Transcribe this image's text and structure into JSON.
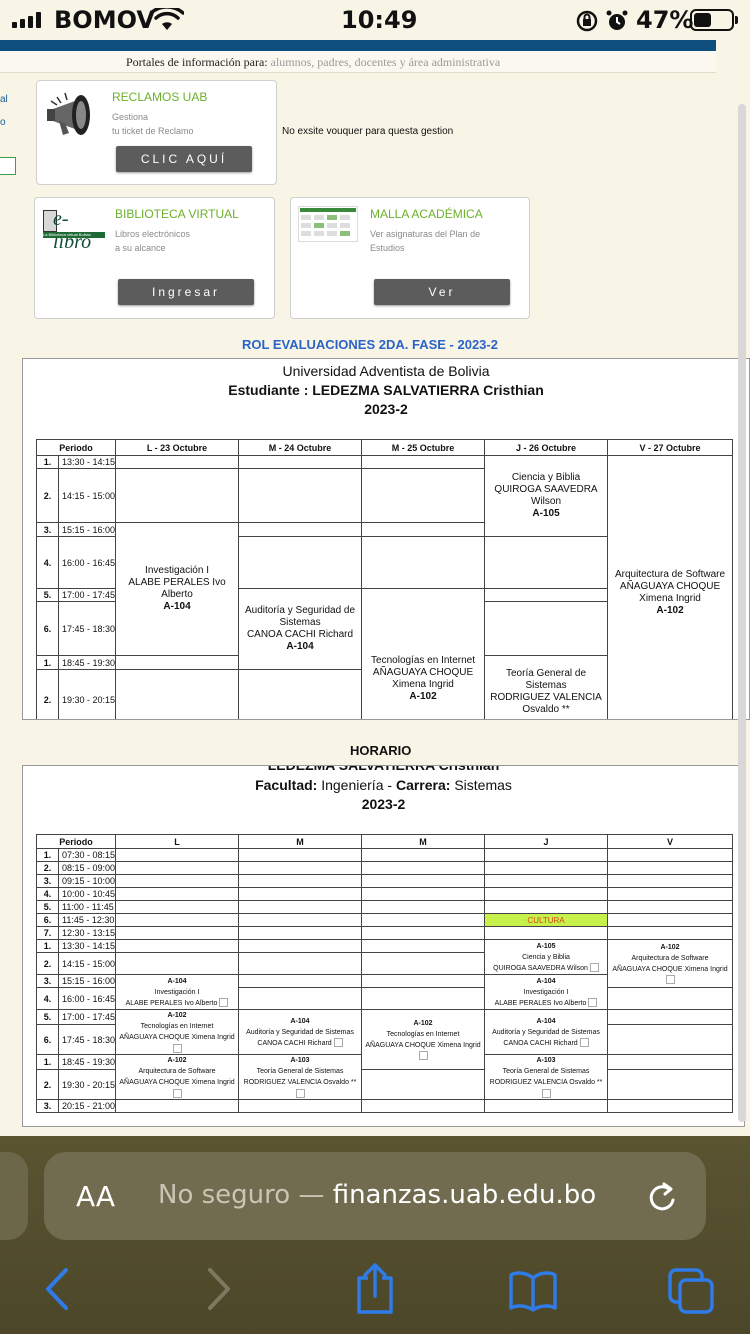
{
  "status_bar": {
    "carrier": "BOMOV",
    "time": "10:49",
    "battery": "47%",
    "battery_level": 0.47
  },
  "header": {
    "portal_label": "Portales de información para:",
    "portal_audience": "alumnos, padres, docentes y área administrativa",
    "left_fragment_1": "al",
    "left_fragment_2": "o"
  },
  "cards": {
    "reclamos": {
      "title": "RECLAMOS UAB",
      "desc1": "Gestiona",
      "desc2": "tu ticket de Reclamo",
      "button": "CLIC AQUÍ",
      "icon": "megaphone-icon"
    },
    "biblioteca": {
      "title": "BIBLIOTECA VIRTUAL",
      "desc1": "Libros electrónicos",
      "desc2": "a su alcance",
      "button": "Ingresar",
      "logo_text": "e-libro",
      "logo_sub": "La Biblioteca virtual Bolivia"
    },
    "malla": {
      "title": "MALLA ACADÉMICA",
      "desc1": "Ver asignaturas del Plan de",
      "desc2": "Estudios",
      "button": "Ver"
    }
  },
  "voucher_msg": "No exsite vouquer para questa gestion",
  "rol": {
    "section_title": "ROL EVALUACIONES 2DA. FASE - 2023-2",
    "university": "Universidad Adventista de Bolivia",
    "student_label": "Estudiante : LEDEZMA SALVATIERRA Cristhian",
    "period": "2023-2",
    "columns": [
      "Periodo",
      "L - 23 Octubre",
      "M - 24 Octubre",
      "M - 25 Octubre",
      "J - 26 Octubre",
      "V - 27 Octubre"
    ],
    "rows": [
      {
        "n": "1.",
        "t": "13:30 - 14:15"
      },
      {
        "n": "2.",
        "t": "14:15 - 15:00"
      },
      {
        "n": "3.",
        "t": "15:15 - 16:00"
      },
      {
        "n": "4.",
        "t": "16:00 - 16:45"
      },
      {
        "n": "5.",
        "t": "17:00 - 17:45"
      },
      {
        "n": "6.",
        "t": "17:45 - 18:30"
      },
      {
        "n": "1.",
        "t": "18:45 - 19:30"
      },
      {
        "n": "2.",
        "t": "19:30 - 20:15"
      }
    ],
    "exams": {
      "ciencia": {
        "name": "Ciencia y Biblia",
        "teacher": "QUIROGA SAAVEDRA Wilson",
        "room": "A-105"
      },
      "arquitectura": {
        "name": "Arquitectura de Software",
        "teacher": "AÑAGUAYA CHOQUE Ximena Ingrid",
        "room": "A-102"
      },
      "investigacion": {
        "name": "Investigación I",
        "teacher": "ALABE PERALES Ivo Alberto",
        "room": "A-104"
      },
      "auditoria": {
        "name": "Auditoría y Seguridad de Sistemas",
        "teacher": "CANOA CACHI Richard",
        "room": "A-104"
      },
      "tecnologias": {
        "name": "Tecnologías en Internet",
        "teacher": "AÑAGUAYA CHOQUE Ximena Ingrid",
        "room": "A-102"
      },
      "teoria": {
        "name": "Teoría General de Sistemas",
        "teacher": "RODRIGUEZ VALENCIA Osvaldo **"
      }
    }
  },
  "horario": {
    "section_title": "HORARIO",
    "cut_name": "LEDEZMA SALVATIERRA Cristhian",
    "facultad_label": "Facultad:",
    "facultad": "Ingeniería",
    "carrera_label": "Carrera:",
    "carrera": "Sistemas",
    "period": "2023-2",
    "columns": [
      "Periodo",
      "L",
      "M",
      "M",
      "J",
      "V"
    ],
    "rows": [
      {
        "n": "1.",
        "t": "07:30 - 08:15"
      },
      {
        "n": "2.",
        "t": "08:15 - 09:00"
      },
      {
        "n": "3.",
        "t": "09:15 - 10:00"
      },
      {
        "n": "4.",
        "t": "10:00 - 10:45"
      },
      {
        "n": "5.",
        "t": "11:00 - 11:45"
      },
      {
        "n": "6.",
        "t": "11:45 - 12:30"
      },
      {
        "n": "7.",
        "t": "12:30 - 13:15"
      },
      {
        "n": "1.",
        "t": "13:30 - 14:15"
      },
      {
        "n": "2.",
        "t": "14:15 - 15:00"
      },
      {
        "n": "3.",
        "t": "15:15 - 16:00"
      },
      {
        "n": "4.",
        "t": "16:00 - 16:45"
      },
      {
        "n": "5.",
        "t": "17:00 - 17:45"
      },
      {
        "n": "6.",
        "t": "17:45 - 18:30"
      },
      {
        "n": "1.",
        "t": "18:45 - 19:30"
      },
      {
        "n": "2.",
        "t": "19:30 - 20:15"
      },
      {
        "n": "3.",
        "t": "20:15 - 21:00"
      }
    ],
    "cultura": "CULTURA",
    "classes": {
      "ciencia": {
        "room": "A-105",
        "name": "Ciencia y Biblia",
        "teacher": "QUIROGA SAAVEDRA Wilson"
      },
      "arq_v": {
        "room": "A-102",
        "name": "Arquitectura de Software",
        "teacher": "AÑAGUAYA CHOQUE Ximena Ingrid"
      },
      "inv_l": {
        "room": "A-104",
        "name": "Investigación I",
        "teacher": "ALABE PERALES Ivo Alberto"
      },
      "inv_j": {
        "room": "A-104",
        "name": "Investigación I",
        "teacher": "ALABE PERALES Ivo Alberto"
      },
      "tec_l": {
        "room": "A-102",
        "name": "Tecnologías en Internet",
        "teacher": "AÑAGUAYA CHOQUE Ximena Ingrid"
      },
      "aud_m": {
        "room": "A-104",
        "name": "Auditoría y Seguridad de Sistemas",
        "teacher": "CANOA CACHI Richard"
      },
      "tec_m": {
        "room": "A-102",
        "name": "Tecnologías en Internet",
        "teacher": "AÑAGUAYA CHOQUE Ximena Ingrid"
      },
      "aud_j": {
        "room": "A-104",
        "name": "Auditoría y Seguridad de Sistemas",
        "teacher": "CANOA CACHI Richard"
      },
      "arq_l": {
        "room": "A-102",
        "name": "Arquitectura de Software",
        "teacher": "AÑAGUAYA CHOQUE Ximena Ingrid"
      },
      "teo_m": {
        "room": "A-103",
        "name": "Teoría General de Sistemas",
        "teacher": "RODRIGUEZ VALENCIA Osvaldo **"
      },
      "teo_j": {
        "room": "A-103",
        "name": "Teoría General de Sistemas",
        "teacher": "RODRIGUEZ VALENCIA Osvaldo **"
      }
    }
  },
  "browser": {
    "text_size_label": "AA",
    "url_prefix": "No seguro —",
    "url_domain": "finanzas.uab.edu.bo",
    "accent": "#2f7be8"
  }
}
